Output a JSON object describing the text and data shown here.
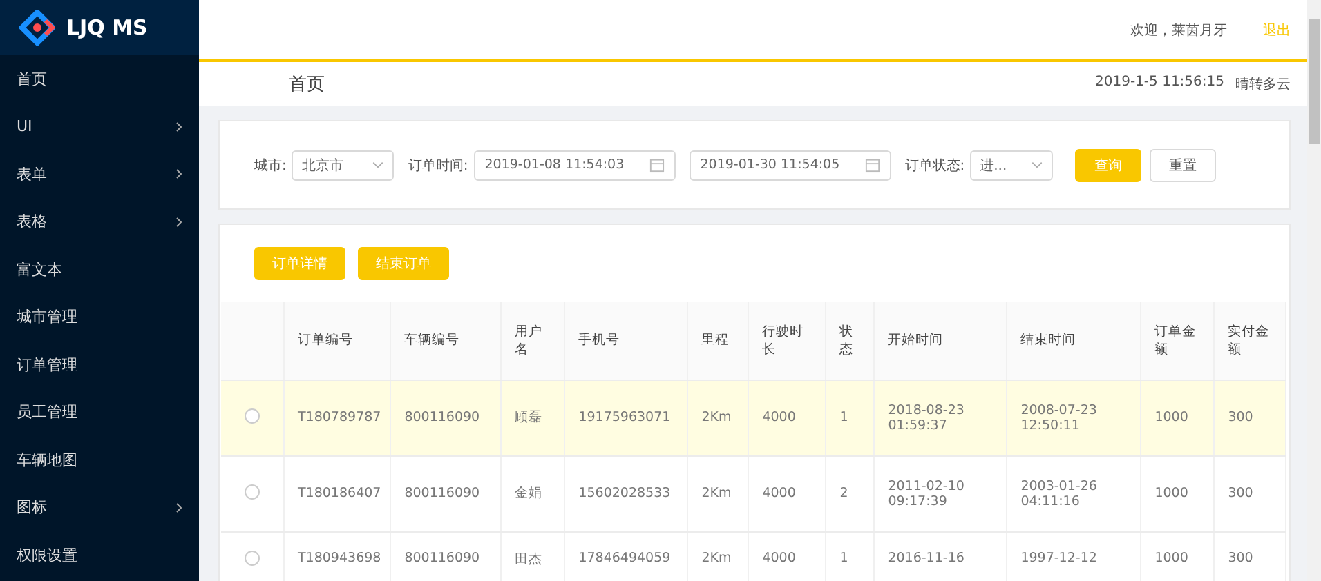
{
  "sidebar": {
    "logo_text": "LJQ MS",
    "items": [
      {
        "label": "首页",
        "has_submenu": false
      },
      {
        "label": "UI",
        "has_submenu": true
      },
      {
        "label": "表单",
        "has_submenu": true
      },
      {
        "label": "表格",
        "has_submenu": true
      },
      {
        "label": "富文本",
        "has_submenu": false
      },
      {
        "label": "城市管理",
        "has_submenu": false
      },
      {
        "label": "订单管理",
        "has_submenu": false
      },
      {
        "label": "员工管理",
        "has_submenu": false
      },
      {
        "label": "车辆地图",
        "has_submenu": false
      },
      {
        "label": "图标",
        "has_submenu": true
      },
      {
        "label": "权限设置",
        "has_submenu": false
      }
    ]
  },
  "header": {
    "welcome": "欢迎，莱茵月牙",
    "logout": "退出"
  },
  "breadcrumb": {
    "title": "首页",
    "datetime": "2019-1-5 11:56:15",
    "weather": "晴转多云"
  },
  "filter": {
    "city_label": "城市:",
    "city_value": "北京市",
    "time_label": "订单时间:",
    "start_time": "2019-01-08 11:54:03",
    "end_time": "2019-01-30 11:54:05",
    "status_label": "订单状态:",
    "status_value": "进...",
    "query_button": "查询",
    "reset_button": "重置"
  },
  "actions": [
    "订单详情",
    "结束订单"
  ],
  "table": {
    "columns": [
      "订单编号",
      "车辆编号",
      "用户名",
      "手机号",
      "里程",
      "行驶时长",
      "状态",
      "开始时间",
      "结束时间",
      "订单金额",
      "实付金额"
    ],
    "rows": [
      {
        "selected": false,
        "hovered": true,
        "cells": [
          "T180789787",
          "800116090",
          "顾磊",
          "19175963071",
          "2Km",
          "4000",
          "1",
          "2018-08-23 01:59:37",
          "2008-07-23 12:50:11",
          "1000",
          "300"
        ]
      },
      {
        "selected": false,
        "hovered": false,
        "cells": [
          "T180186407",
          "800116090",
          "金娟",
          "15602028533",
          "2Km",
          "4000",
          "2",
          "2011-02-10 09:17:39",
          "2003-01-26 04:11:16",
          "1000",
          "300"
        ]
      },
      {
        "selected": false,
        "hovered": false,
        "cells": [
          "T180943698",
          "800116090",
          "田杰",
          "17846494059",
          "2Km",
          "4000",
          "1",
          "2016-11-16",
          "1997-12-12",
          "1000",
          "300"
        ]
      }
    ]
  }
}
